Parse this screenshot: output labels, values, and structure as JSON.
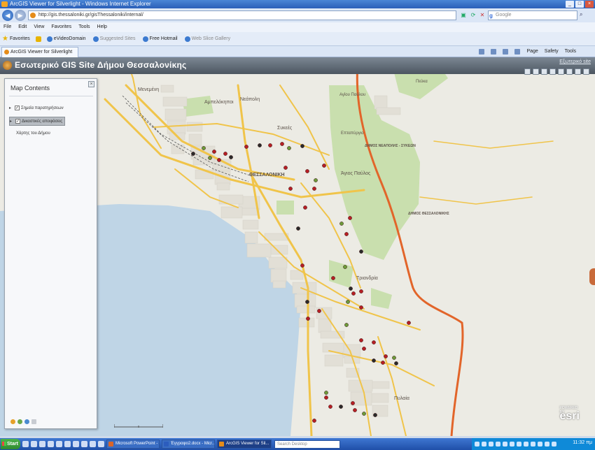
{
  "browser": {
    "title": "ArcGIS Viewer for Silverlight - Windows Internet Explorer",
    "url": "http://gis.thessaloniki.gr/gisThessaloniki/internal/",
    "search_placeholder": "Google",
    "menu": [
      "File",
      "Edit",
      "View",
      "Favorites",
      "Tools",
      "Help"
    ],
    "favorites_label": "Favorites",
    "favorites": [
      {
        "label": "eVideoDomain",
        "dim": false
      },
      {
        "label": "Suggested Sites",
        "dim": true
      },
      {
        "label": "Free Hotmail",
        "dim": false
      },
      {
        "label": "Web Slice Gallery",
        "dim": true
      }
    ],
    "tab_label": "ArcGIS Viewer for Silverlight",
    "commands": [
      "Page",
      "Safety",
      "Tools"
    ]
  },
  "app": {
    "title": "Εσωτερικό GIS Site Δήμου Θεσσαλονίκης",
    "external_link": "Εξωτερικό site",
    "panel": {
      "title": "Map Contents",
      "layers": [
        {
          "label": "Σημεία παρατηρήσεων",
          "checked": true,
          "selected": false
        },
        {
          "label": "Δικαστικές αποφάσεις",
          "checked": true,
          "selected": true
        }
      ],
      "basemap_label": "Χάρτης του Δήμου"
    },
    "esri_label": "esri",
    "esri_sub": "POWERED BY"
  },
  "map": {
    "colors": {
      "water": "#bfd5e6",
      "land": "#ecebe4",
      "park": "#c9dfae",
      "road": "#f0c44a",
      "highway": "#e2652a"
    },
    "places": [
      {
        "name": "Μενεμένη"
      },
      {
        "name": "Αμπελόκηποι"
      },
      {
        "name": "Νεάπολη"
      },
      {
        "name": "Αγίου Παύλου"
      },
      {
        "name": "Πεύκα"
      },
      {
        "name": "Συκεές"
      },
      {
        "name": "Επταπύργιο"
      },
      {
        "name": "ΘΕΣΣΑΛΟΝΙΚΗ"
      },
      {
        "name": "Άγιος Παύλος"
      },
      {
        "name": "ΔΗΜΟΣ ΝΕΑΠΟΛΗΣ - ΣΥΚΕΩΝ"
      },
      {
        "name": "ΔΗΜΟΣ ΘΕΣΣΑΛΟΝΙΚΗΣ"
      },
      {
        "name": "Τριανδρία"
      },
      {
        "name": "Πυλαία"
      }
    ]
  },
  "taskbar": {
    "start": "Start",
    "tasks": [
      {
        "label": "Microsoft PowerPoint - ...",
        "color": "#d9652a",
        "active": false
      },
      {
        "label": "Έγγραφο2.docx - Micr...",
        "color": "#2c5dbd",
        "active": false
      },
      {
        "label": "ArcGIS Viewer for Sil...",
        "color": "#e58c1a",
        "active": true
      }
    ],
    "search": "Search Desktop",
    "clock": "11:32 πμ"
  }
}
